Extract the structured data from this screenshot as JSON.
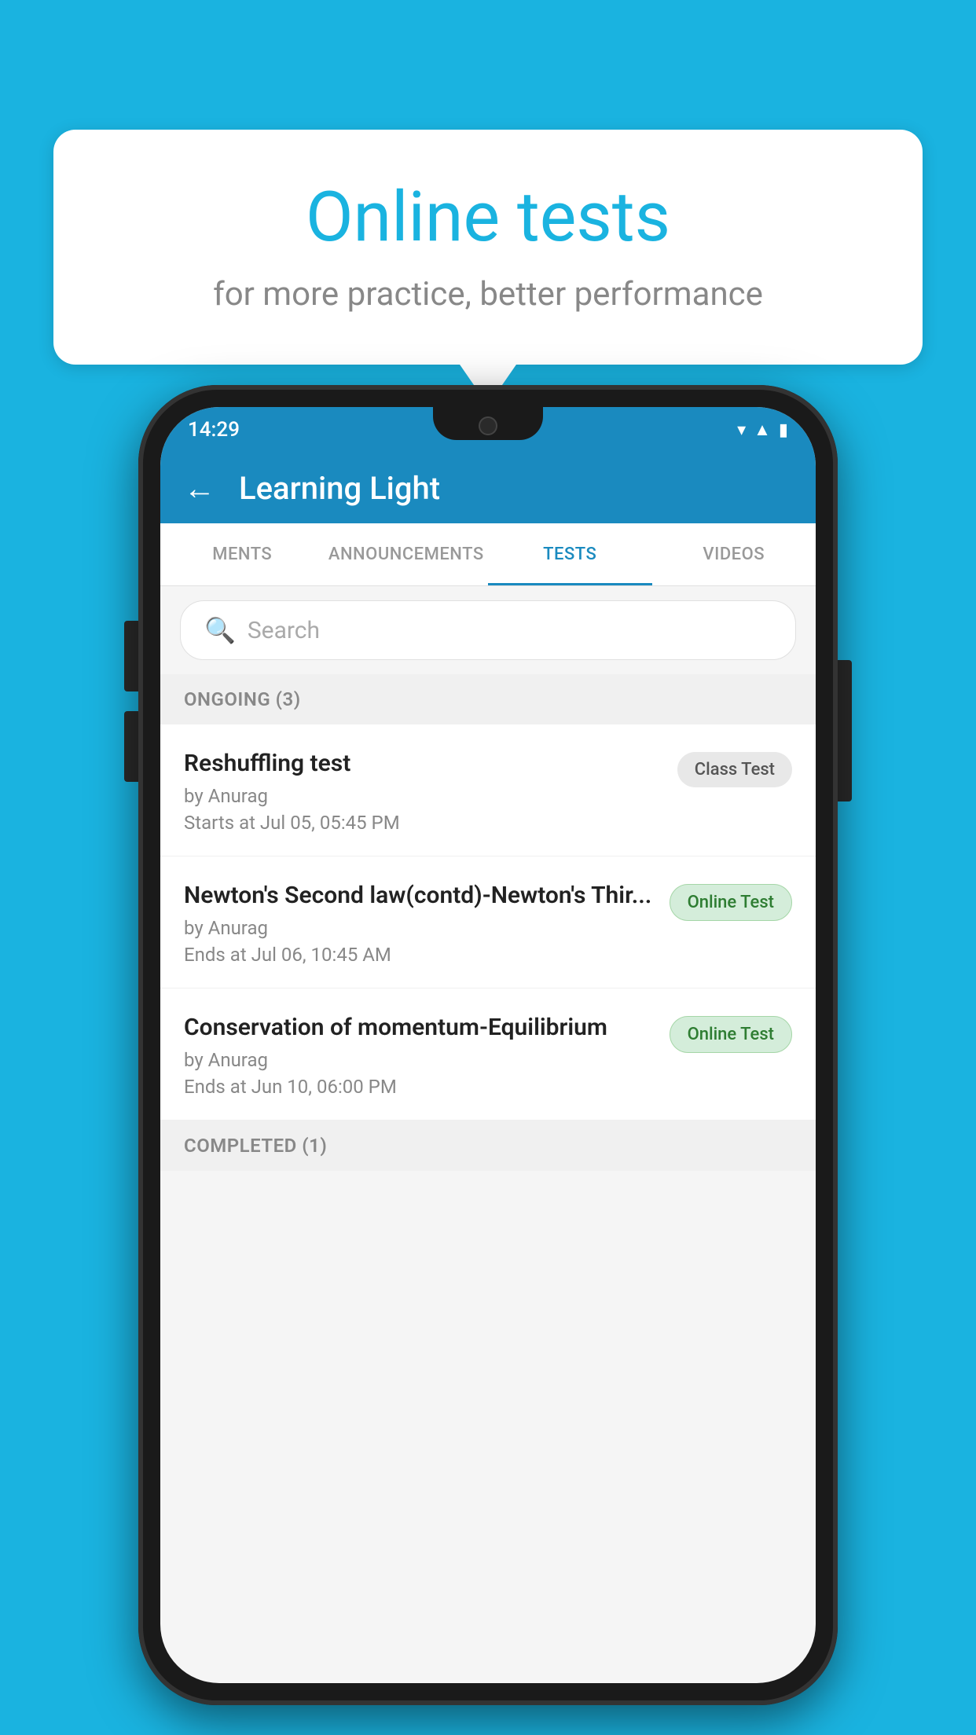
{
  "background": {
    "color": "#1ab3e0"
  },
  "bubble": {
    "title": "Online tests",
    "subtitle": "for more practice, better performance"
  },
  "phone": {
    "status_bar": {
      "time": "14:29",
      "icons": [
        "wifi",
        "signal",
        "battery"
      ]
    },
    "header": {
      "back_label": "←",
      "title": "Learning Light"
    },
    "tabs": [
      {
        "label": "MENTS",
        "active": false
      },
      {
        "label": "ANNOUNCEMENTS",
        "active": false
      },
      {
        "label": "TESTS",
        "active": true
      },
      {
        "label": "VIDEOS",
        "active": false
      }
    ],
    "search": {
      "placeholder": "Search"
    },
    "ongoing_section": {
      "label": "ONGOING (3)"
    },
    "tests": [
      {
        "name": "Reshuffling test",
        "author": "by Anurag",
        "time": "Starts at  Jul 05, 05:45 PM",
        "badge": "Class Test",
        "badge_type": "class"
      },
      {
        "name": "Newton's Second law(contd)-Newton's Thir...",
        "author": "by Anurag",
        "time": "Ends at  Jul 06, 10:45 AM",
        "badge": "Online Test",
        "badge_type": "online"
      },
      {
        "name": "Conservation of momentum-Equilibrium",
        "author": "by Anurag",
        "time": "Ends at  Jun 10, 06:00 PM",
        "badge": "Online Test",
        "badge_type": "online"
      }
    ],
    "completed_section": {
      "label": "COMPLETED (1)"
    }
  }
}
